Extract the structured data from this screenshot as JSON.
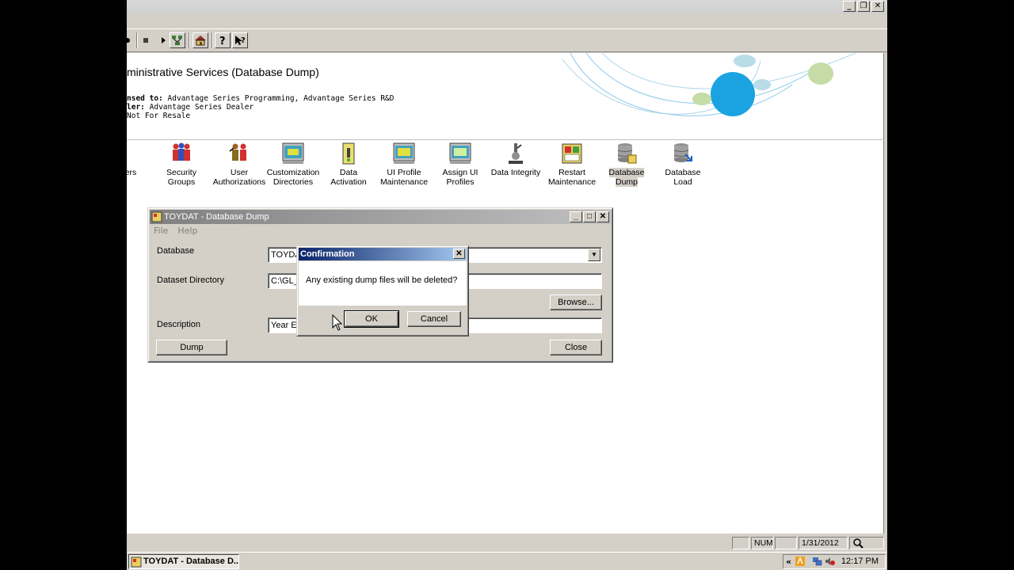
{
  "window": {
    "ctrl_min": "_",
    "ctrl_max": "❐",
    "ctrl_close": "✕"
  },
  "toolbar": {
    "icons": [
      "back-icon",
      "stop-icon",
      "forward-icon",
      "tree-icon",
      "home-icon",
      "help-icon",
      "context-help-icon"
    ]
  },
  "header": {
    "title": "ministrative Services (Database Dump)",
    "licensed_prefix": "nsed to:",
    "licensed_value": "Advantage Series Programming, Advantage Series R&D",
    "dealer_prefix": "ler:",
    "dealer_value": "Advantage Series Dealer",
    "resale": "Not For Resale"
  },
  "launcher": {
    "items": [
      {
        "label": "ers",
        "label2": "",
        "icon": "users-icon"
      },
      {
        "label": "Security",
        "label2": "Groups",
        "icon": "security-groups-icon"
      },
      {
        "label": "User",
        "label2": "Authorizations",
        "icon": "user-authorizations-icon"
      },
      {
        "label": "Customization",
        "label2": "Directories",
        "icon": "customization-directories-icon"
      },
      {
        "label": "Data",
        "label2": "Activation",
        "icon": "data-activation-icon"
      },
      {
        "label": "UI Profile",
        "label2": "Maintenance",
        "icon": "ui-profile-maintenance-icon"
      },
      {
        "label": "Assign UI",
        "label2": "Profiles",
        "icon": "assign-ui-profiles-icon"
      },
      {
        "label": "Data Integrity",
        "label2": "",
        "icon": "data-integrity-icon"
      },
      {
        "label": "Restart",
        "label2": "Maintenance",
        "icon": "restart-maintenance-icon"
      },
      {
        "label": "Database",
        "label2": "Dump",
        "icon": "database-dump-icon"
      },
      {
        "label": "Database",
        "label2": "Load",
        "icon": "database-load-icon"
      }
    ]
  },
  "dump_window": {
    "title": "TOYDAT - Database Dump",
    "menu_file": "File",
    "menu_help": "Help",
    "database_label": "Database",
    "database_value": "TOYDA",
    "dataset_dir_label": "Dataset Directory",
    "dataset_dir_value": "C:\\GL_",
    "browse_label": "Browse...",
    "description_label": "Description",
    "description_value": "Year E",
    "dump_label": "Dump",
    "close_label": "Close"
  },
  "confirmation": {
    "title": "Confirmation",
    "message": "Any existing dump files will be deleted?",
    "ok_label": "OK",
    "cancel_label": "Cancel"
  },
  "statusbar": {
    "num": "NUM",
    "date": "1/31/2012"
  },
  "taskbar": {
    "task_label": "TOYDAT - Database D...",
    "clock": "12:17 PM",
    "tray_chevron": "«"
  },
  "colors": {
    "title_active": "#0a246a",
    "title_inactive": "#808080",
    "swirl_blue": "#1aa3e0",
    "swirl_green": "#c5dca6"
  }
}
